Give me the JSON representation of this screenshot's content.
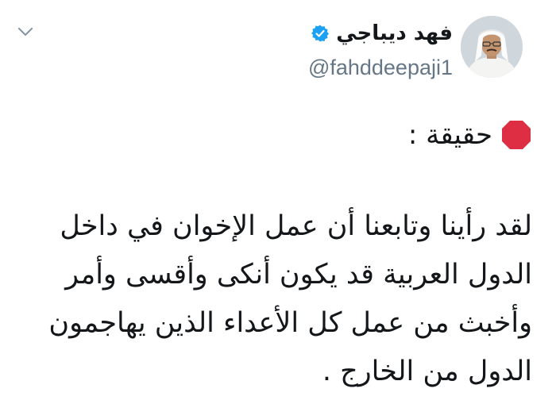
{
  "tweet": {
    "author": {
      "display_name": "فهد ديباجي",
      "handle": "@fahddeepaji1",
      "verified": true
    },
    "heading": {
      "emoji": "stop-sign",
      "text": "حقيقة :"
    },
    "body_lines": [
      "لقد رأينا وتابعنا أن عمل الإخوان في داخل",
      "الدول العربية قد يكون أنكى وأقسى وأمر",
      "وأخبث من عمل كل الأعداء الذين يهاجمون",
      "الدول من الخارج ."
    ]
  },
  "colors": {
    "text": "#14171a",
    "secondary": "#657786",
    "verified": "#1da1f2",
    "stop_sign": "#dd2e44"
  }
}
